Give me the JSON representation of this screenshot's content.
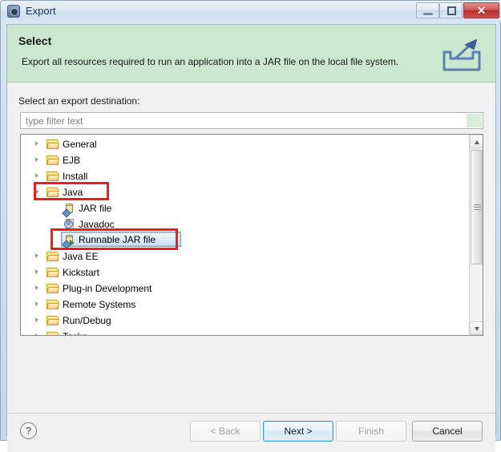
{
  "window": {
    "title": "Export",
    "icon": "export-gear-icon",
    "controls": {
      "minimize": "minimize-icon",
      "maximize": "maximize-icon",
      "close": "✕"
    }
  },
  "header": {
    "title": "Select",
    "description": "Export all resources required to run an application into a JAR file on the local file system.",
    "icon": "export-tray-arrow-icon",
    "background_color": "#cbe7cd"
  },
  "body": {
    "destination_label": "Select an export destination:",
    "filter": {
      "placeholder": "type filter text",
      "value": ""
    },
    "tree": [
      {
        "label": "General",
        "level": 0,
        "expandable": true,
        "expanded": false,
        "icon": "folder-icon"
      },
      {
        "label": "EJB",
        "level": 0,
        "expandable": true,
        "expanded": false,
        "icon": "folder-icon"
      },
      {
        "label": "Install",
        "level": 0,
        "expandable": true,
        "expanded": false,
        "icon": "folder-icon"
      },
      {
        "label": "Java",
        "level": 0,
        "expandable": true,
        "expanded": true,
        "icon": "folder-icon"
      },
      {
        "label": "JAR file",
        "level": 1,
        "expandable": false,
        "expanded": false,
        "icon": "jar-file-icon"
      },
      {
        "label": "Javadoc",
        "level": 1,
        "expandable": false,
        "expanded": false,
        "icon": "javadoc-icon"
      },
      {
        "label": "Runnable JAR file",
        "level": 1,
        "expandable": false,
        "expanded": false,
        "icon": "runnable-jar-file-icon",
        "selected": true
      },
      {
        "label": "Java EE",
        "level": 0,
        "expandable": true,
        "expanded": false,
        "icon": "folder-icon"
      },
      {
        "label": "Kickstart",
        "level": 0,
        "expandable": true,
        "expanded": false,
        "icon": "folder-icon"
      },
      {
        "label": "Plug-in Development",
        "level": 0,
        "expandable": true,
        "expanded": false,
        "icon": "folder-icon"
      },
      {
        "label": "Remote Systems",
        "level": 0,
        "expandable": true,
        "expanded": false,
        "icon": "folder-icon"
      },
      {
        "label": "Run/Debug",
        "level": 0,
        "expandable": true,
        "expanded": false,
        "icon": "folder-icon"
      },
      {
        "label": "Tasks",
        "level": 0,
        "expandable": true,
        "expanded": false,
        "icon": "folder-icon",
        "clipped": true
      }
    ],
    "annotations": {
      "color": "#ee1b24",
      "boxes": [
        "java-node-highlight",
        "runnable-jar-file-highlight"
      ]
    }
  },
  "buttons": {
    "help": "?",
    "back": {
      "label": "< Back",
      "enabled": false
    },
    "next": {
      "label": "Next >",
      "enabled": true,
      "default": true
    },
    "finish": {
      "label": "Finish",
      "enabled": false
    },
    "cancel": {
      "label": "Cancel",
      "enabled": true
    }
  }
}
